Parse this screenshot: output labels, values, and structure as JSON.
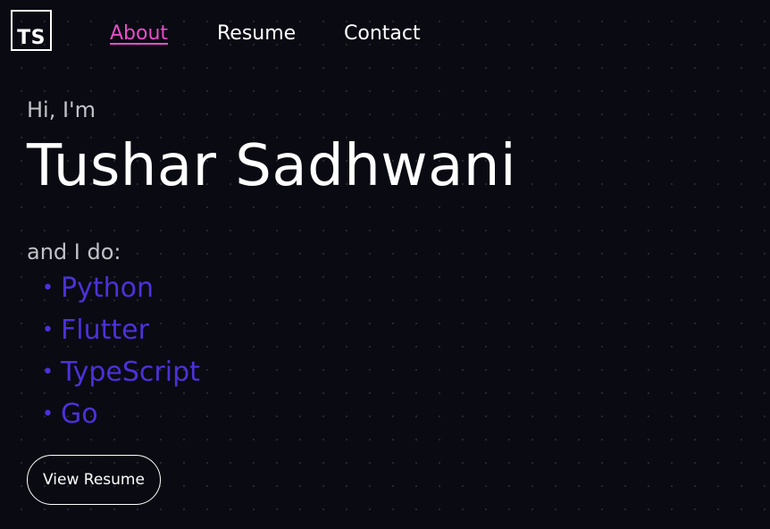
{
  "nav": {
    "logo_text": "TS",
    "links": [
      {
        "label": "About",
        "active": true
      },
      {
        "label": "Resume",
        "active": false
      },
      {
        "label": "Contact",
        "active": false
      }
    ]
  },
  "hero": {
    "greeting": "Hi, I'm",
    "name": "Tushar Sadhwani",
    "intro": "and I do:",
    "skills": [
      "Python",
      "Flutter",
      "TypeScript",
      "Go"
    ],
    "bullet": "•",
    "cta_label": "View Resume"
  },
  "colors": {
    "background": "#0a0a13",
    "active_link": "#e64ec8",
    "skill": "#4a32d8",
    "muted_text": "#c2c2c9",
    "text": "#ffffff"
  }
}
